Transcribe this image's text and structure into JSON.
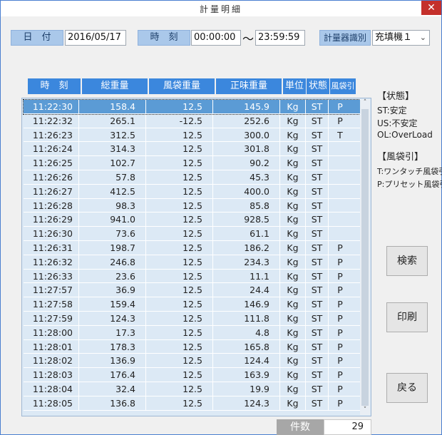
{
  "window": {
    "title": "計量明細",
    "close": "✕"
  },
  "filters": {
    "date_label": "日　付",
    "date_value": "2016/05/17",
    "time_label": "時　刻",
    "time_from": "00:00:00",
    "tilde": "～",
    "time_to": "23:59:59",
    "machine_label": "計量器識別",
    "machine_value": "充填機１",
    "chevron": "⌄"
  },
  "columns": [
    "時　刻",
    "総重量",
    "風袋重量",
    "正味重量",
    "単位",
    "状態",
    "風袋引"
  ],
  "rows": [
    [
      "11:22:30",
      "158.4",
      "12.5",
      "145.9",
      "Kg",
      "ST",
      "P"
    ],
    [
      "11:22:32",
      "265.1",
      "-12.5",
      "252.6",
      "Kg",
      "ST",
      "P"
    ],
    [
      "11:26:23",
      "312.5",
      "12.5",
      "300.0",
      "Kg",
      "ST",
      "T"
    ],
    [
      "11:26:24",
      "314.3",
      "12.5",
      "301.8",
      "Kg",
      "ST",
      ""
    ],
    [
      "11:26:25",
      "102.7",
      "12.5",
      "90.2",
      "Kg",
      "ST",
      ""
    ],
    [
      "11:26:26",
      "57.8",
      "12.5",
      "45.3",
      "Kg",
      "ST",
      ""
    ],
    [
      "11:26:27",
      "412.5",
      "12.5",
      "400.0",
      "Kg",
      "ST",
      ""
    ],
    [
      "11:26:28",
      "98.3",
      "12.5",
      "85.8",
      "Kg",
      "ST",
      ""
    ],
    [
      "11:26:29",
      "941.0",
      "12.5",
      "928.5",
      "Kg",
      "ST",
      ""
    ],
    [
      "11:26:30",
      "73.6",
      "12.5",
      "61.1",
      "Kg",
      "ST",
      ""
    ],
    [
      "11:26:31",
      "198.7",
      "12.5",
      "186.2",
      "Kg",
      "ST",
      "P"
    ],
    [
      "11:26:32",
      "246.8",
      "12.5",
      "234.3",
      "Kg",
      "ST",
      "P"
    ],
    [
      "11:26:33",
      "23.6",
      "12.5",
      "11.1",
      "Kg",
      "ST",
      "P"
    ],
    [
      "11:27:57",
      "36.9",
      "12.5",
      "24.4",
      "Kg",
      "ST",
      "P"
    ],
    [
      "11:27:58",
      "159.4",
      "12.5",
      "146.9",
      "Kg",
      "ST",
      "P"
    ],
    [
      "11:27:59",
      "124.3",
      "12.5",
      "111.8",
      "Kg",
      "ST",
      "P"
    ],
    [
      "11:28:00",
      "17.3",
      "12.5",
      "4.8",
      "Kg",
      "ST",
      "P"
    ],
    [
      "11:28:01",
      "178.3",
      "12.5",
      "165.8",
      "Kg",
      "ST",
      "P"
    ],
    [
      "11:28:02",
      "136.9",
      "12.5",
      "124.4",
      "Kg",
      "ST",
      "P"
    ],
    [
      "11:28:03",
      "176.4",
      "12.5",
      "163.9",
      "Kg",
      "ST",
      "P"
    ],
    [
      "11:28:04",
      "32.4",
      "12.5",
      "19.9",
      "Kg",
      "ST",
      "P"
    ],
    [
      "11:28:05",
      "136.8",
      "12.5",
      "124.3",
      "Kg",
      "ST",
      "P"
    ]
  ],
  "selected_row": 0,
  "legend": {
    "status_title": "【状態】",
    "status_items": [
      "ST:安定",
      "US:不安定",
      "OL:OverLoad"
    ],
    "tare_title": "【風袋引】",
    "tare_items": [
      "T:ワンタッチ風袋引",
      "P:プリセット風袋引"
    ]
  },
  "buttons": {
    "search": "検索",
    "print": "印刷",
    "back": "戻る"
  },
  "count": {
    "label": "件数",
    "value": "29"
  },
  "scroll": {
    "up": "˄",
    "down": "˅"
  }
}
